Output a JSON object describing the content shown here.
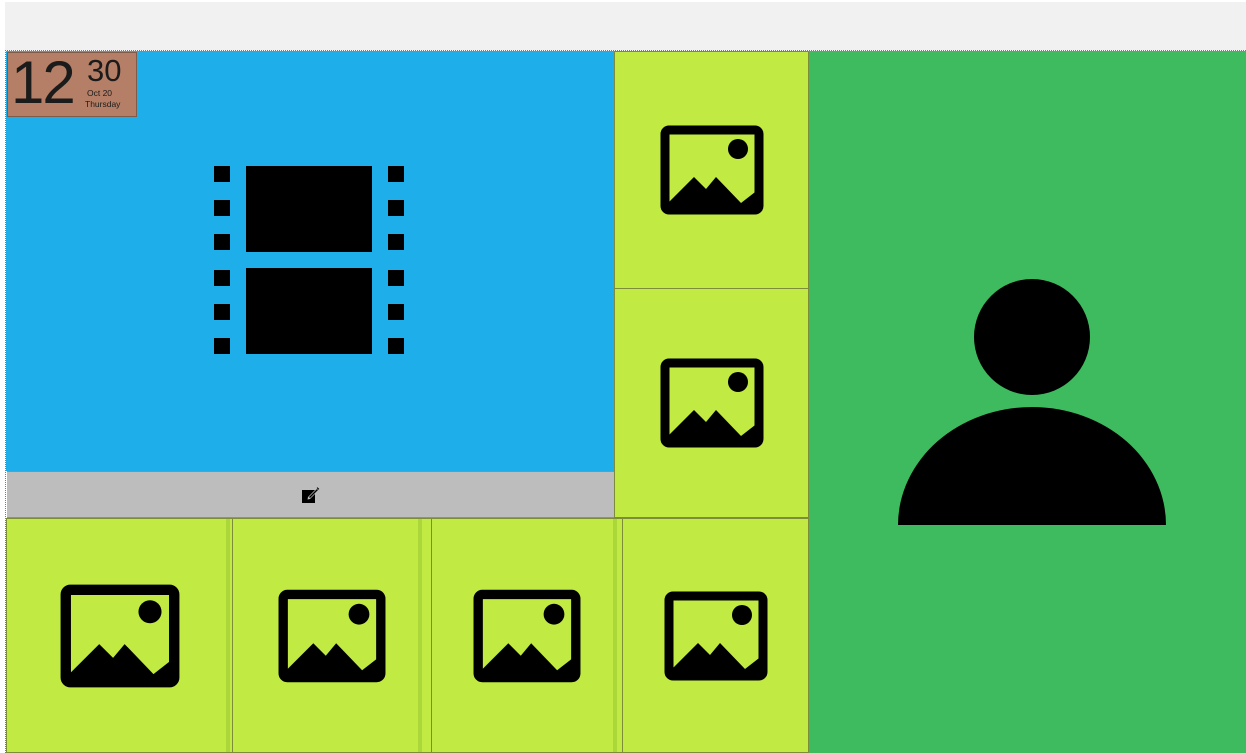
{
  "clock": {
    "hour": "12",
    "minutes": "30",
    "date": "Oct 20",
    "day": "Thursday"
  },
  "tiles": {
    "video": {
      "icon": "film-strip-icon"
    },
    "photos": [
      {
        "icon": "image-icon"
      },
      {
        "icon": "image-icon"
      },
      {
        "icon": "image-icon"
      },
      {
        "icon": "image-icon"
      },
      {
        "icon": "image-icon"
      },
      {
        "icon": "image-icon"
      }
    ],
    "contact": {
      "icon": "person-icon"
    }
  },
  "edit_bar": {
    "icon": "edit-icon"
  },
  "colors": {
    "blue": "#1eaeea",
    "lime": "#c1ea43",
    "green": "#3dbb5e",
    "edit_gray": "#bdbdbd",
    "clock_brown": "#b47f66"
  }
}
